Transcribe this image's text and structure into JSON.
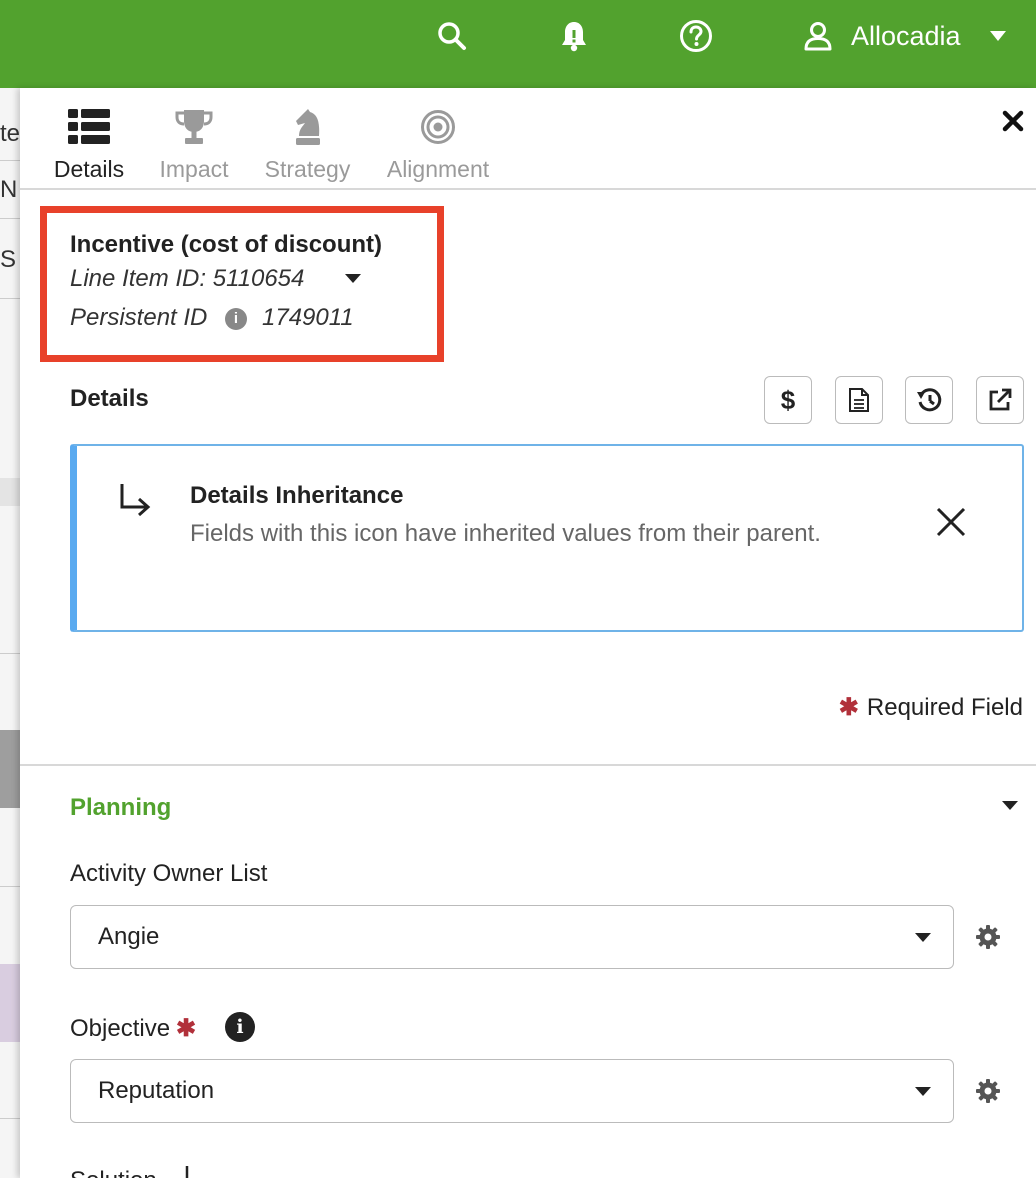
{
  "topbar": {
    "icons": [
      "search-icon",
      "bell-icon",
      "help-icon",
      "user-icon",
      "chevron-down-icon"
    ],
    "user_name": "Allocadia",
    "color": "#52a22e"
  },
  "background_fragments": [
    "te",
    "N",
    "S"
  ],
  "tabs": [
    {
      "label": "Details",
      "icon": "list-icon",
      "active": true
    },
    {
      "label": "Impact",
      "icon": "trophy-icon",
      "active": false
    },
    {
      "label": "Strategy",
      "icon": "chess-knight-icon",
      "active": false
    },
    {
      "label": "Alignment",
      "icon": "target-icon",
      "active": false
    }
  ],
  "line_item": {
    "title": "Incentive (cost of discount)",
    "id_text": "Line Item ID: 5110654",
    "persistent_label": "Persistent ID",
    "persistent_value": "1749011"
  },
  "details": {
    "heading": "Details",
    "toolbar": [
      "dollar-icon",
      "document-icon",
      "history-icon",
      "external-link-icon"
    ]
  },
  "callout": {
    "title": "Details Inheritance",
    "body": "Fields with this icon have inherited values from their parent.",
    "accent": "#5aaaf0"
  },
  "required_text": "Required Field",
  "planning": {
    "title": "Planning",
    "title_color": "#52a22e",
    "fields": [
      {
        "label": "Activity Owner List",
        "value": "Angie",
        "required": false
      },
      {
        "label": "Objective",
        "value": "Reputation",
        "required": true
      }
    ],
    "next_label": "Solution"
  }
}
